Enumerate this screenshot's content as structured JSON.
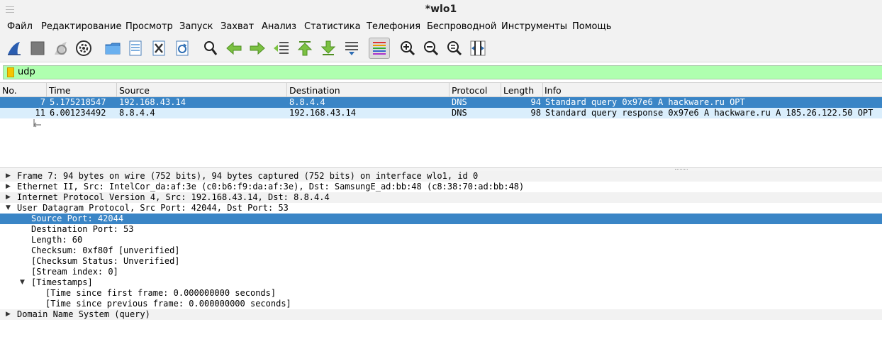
{
  "window": {
    "title": "*wlo1"
  },
  "menu": [
    "Файл",
    "Редактирование",
    "Просмотр",
    "Запуск",
    "Захват",
    "Анализ",
    "Статистика",
    "Телефония",
    "Беспроводной",
    "Инструменты",
    "Помощь"
  ],
  "toolbar": {
    "icons": [
      "shark-fin-start-icon",
      "stop-square-icon",
      "restart-capture-icon",
      "capture-options-gear-icon",
      "open-folder-icon",
      "save-file-icon",
      "close-file-icon",
      "reload-file-icon",
      "find-packet-magnifier-icon",
      "go-back-arrow-icon",
      "go-forward-arrow-icon",
      "go-to-packet-icon",
      "go-first-packet-icon",
      "go-last-packet-icon",
      "autoscroll-icon",
      "colorize-lines-icon",
      "zoom-in-icon",
      "zoom-out-icon",
      "zoom-normal-icon",
      "resize-columns-icon"
    ]
  },
  "filter": {
    "value": "udp"
  },
  "packet_list": {
    "columns": [
      "No.",
      "Time",
      "Source",
      "Destination",
      "Protocol",
      "Length",
      "Info"
    ],
    "rows": [
      {
        "no": "7",
        "time": "5.175218547",
        "source": "192.168.43.14",
        "destination": "8.8.4.4",
        "protocol": "DNS",
        "length": "94",
        "info": "Standard query 0x97e6 A hackware.ru OPT",
        "selected": true
      },
      {
        "no": "11",
        "time": "6.001234492",
        "source": "8.8.4.4",
        "destination": "192.168.43.14",
        "protocol": "DNS",
        "length": "98",
        "info": "Standard query response 0x97e6 A hackware.ru A 185.26.122.50 OPT",
        "selected": false
      }
    ]
  },
  "details": {
    "lines": [
      {
        "text": "Frame 7: 94 bytes on wire (752 bits), 94 bytes captured (752 bits) on interface wlo1, id 0",
        "level": 0,
        "state": "collapsed"
      },
      {
        "text": "Ethernet II, Src: IntelCor_da:af:3e (c0:b6:f9:da:af:3e), Dst: SamsungE_ad:bb:48 (c8:38:70:ad:bb:48)",
        "level": 0,
        "state": "collapsed"
      },
      {
        "text": "Internet Protocol Version 4, Src: 192.168.43.14, Dst: 8.8.4.4",
        "level": 0,
        "state": "collapsed"
      },
      {
        "text": "User Datagram Protocol, Src Port: 42044, Dst Port: 53",
        "level": 0,
        "state": "expanded"
      },
      {
        "text": "Source Port: 42044",
        "level": 1,
        "state": "leaf",
        "selected": true
      },
      {
        "text": "Destination Port: 53",
        "level": 1,
        "state": "leaf"
      },
      {
        "text": "Length: 60",
        "level": 1,
        "state": "leaf"
      },
      {
        "text": "Checksum: 0xf80f [unverified]",
        "level": 1,
        "state": "leaf"
      },
      {
        "text": "[Checksum Status: Unverified]",
        "level": 1,
        "state": "leaf"
      },
      {
        "text": "[Stream index: 0]",
        "level": 1,
        "state": "leaf"
      },
      {
        "text": "[Timestamps]",
        "level": 1,
        "state": "expanded"
      },
      {
        "text": "[Time since first frame: 0.000000000 seconds]",
        "level": 2,
        "state": "leaf"
      },
      {
        "text": "[Time since previous frame: 0.000000000 seconds]",
        "level": 2,
        "state": "leaf"
      },
      {
        "text": "Domain Name System (query)",
        "level": 0,
        "state": "collapsed"
      }
    ]
  },
  "colors": {
    "selection": "#3a85c6",
    "alt_row": "#daeefc",
    "filter_ok": "#afffaf"
  }
}
